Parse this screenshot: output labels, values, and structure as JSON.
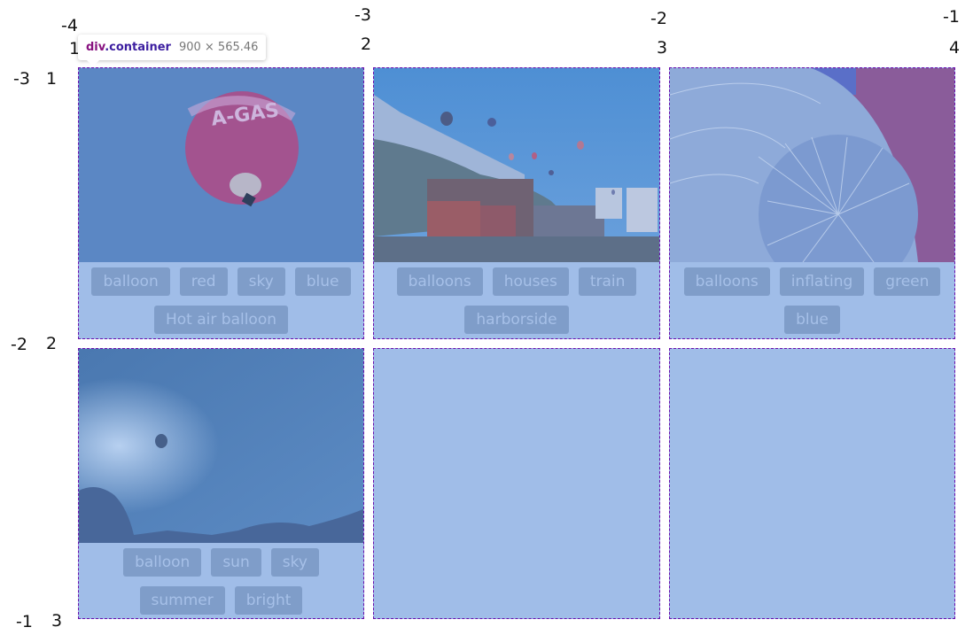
{
  "tooltip": {
    "element_tag": "div",
    "element_class": ".container",
    "dimensions": "900 × 565.46"
  },
  "grid_lines": {
    "columns_negative": [
      "-4",
      "-3",
      "-2",
      "-1"
    ],
    "columns_positive": [
      "1",
      "2",
      "3",
      "4"
    ],
    "rows_negative": [
      "-3",
      "-2",
      "-1"
    ],
    "rows_positive": [
      "1",
      "2",
      "3"
    ]
  },
  "overlay_color": "#a0bde8",
  "border_color": "#6a0dad",
  "cards": [
    {
      "image": "hot-air-balloon-a-gas-red",
      "tags": [
        "balloon",
        "red",
        "sky",
        "blue",
        "Hot air balloon"
      ]
    },
    {
      "image": "balloons-over-houses-and-train",
      "tags": [
        "balloons",
        "houses",
        "train",
        "harborside"
      ]
    },
    {
      "image": "balloons-inflating",
      "tags": [
        "balloons",
        "inflating",
        "green",
        "blue"
      ]
    },
    {
      "image": "balloon-in-bright-summer-sky",
      "tags": [
        "balloon",
        "sun",
        "sky",
        "summer",
        "bright"
      ]
    },
    {
      "image": "",
      "tags": []
    },
    {
      "image": "",
      "tags": []
    }
  ]
}
